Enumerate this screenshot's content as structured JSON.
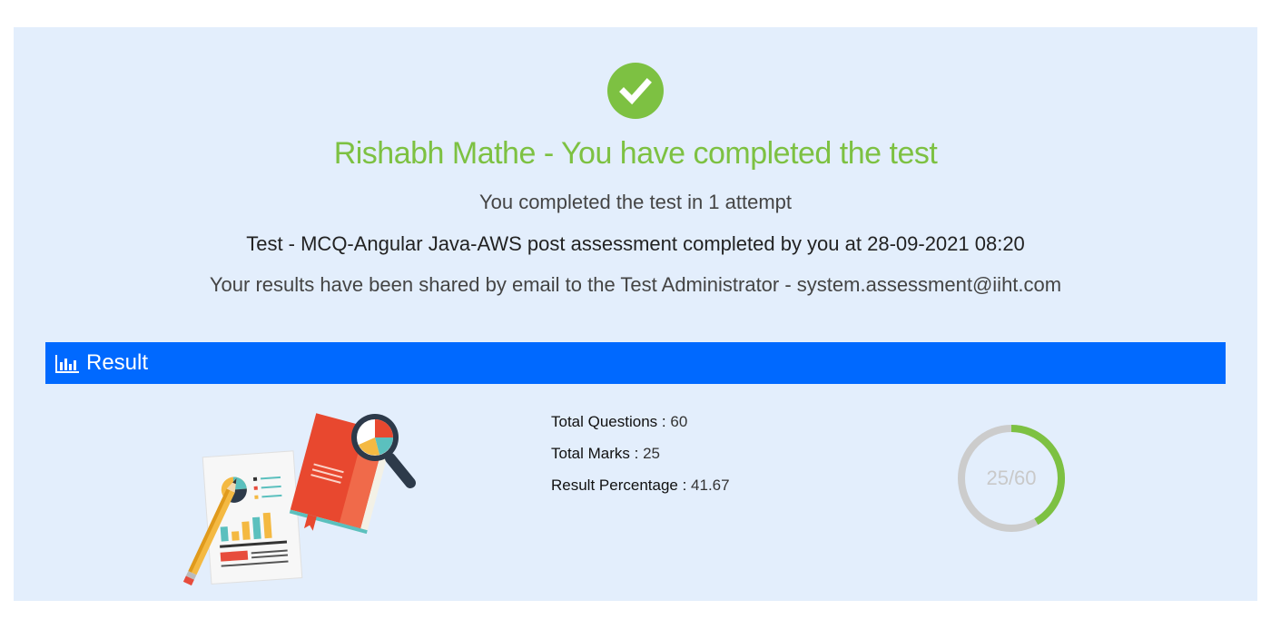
{
  "header": {
    "title": "Rishabh Mathe - You have completed the test",
    "attempt_text": "You completed the test in 1 attempt",
    "test_text": "Test - MCQ-Angular Java-AWS post assessment completed by you at 28-09-2021 08:20",
    "email_text": "Your results have been shared by email to the Test Administrator - system.assessment@iiht.com",
    "status_icon": "check-circle-icon"
  },
  "result": {
    "bar_label": "Result",
    "bar_icon": "bar-chart-icon",
    "stats": [
      {
        "label": "Total Questions",
        "sep": " : ",
        "value": "60"
      },
      {
        "label": "Total Marks",
        "sep": " : ",
        "value": "25"
      },
      {
        "label": "Result Percentage",
        "sep": " : ",
        "value": "41.67"
      }
    ],
    "score_text": "25/60",
    "score_fraction": 0.4167
  },
  "colors": {
    "panel_bg": "#e3eefc",
    "success_green": "#7dc142",
    "result_bar_blue": "#0069ff",
    "donut_track": "#cccccc"
  }
}
